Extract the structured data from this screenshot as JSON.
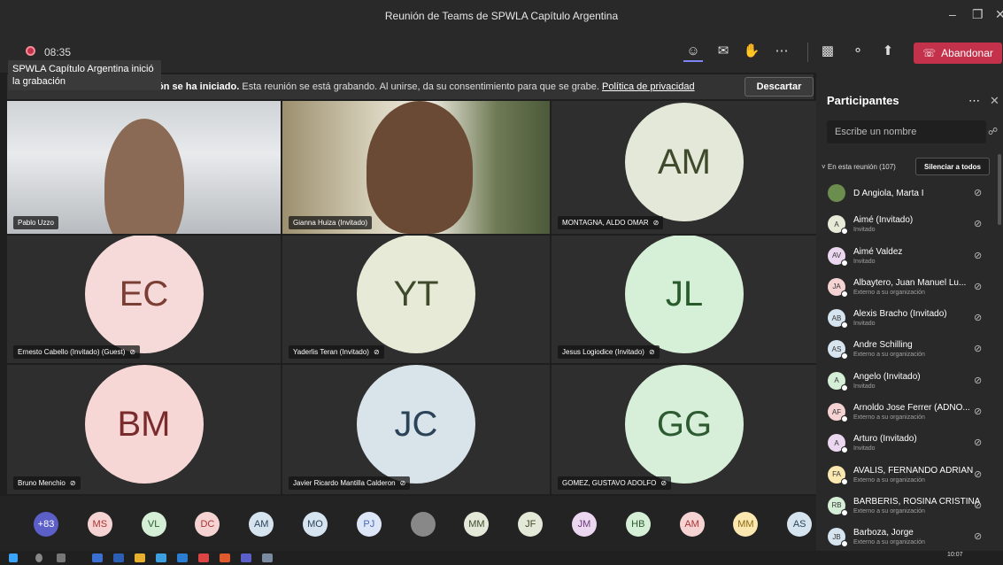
{
  "window": {
    "title": "Reunión de Teams de SPWLA Capítulo Argentina"
  },
  "toolbar": {
    "timer": "08:35",
    "leave_label": "Abandonar"
  },
  "tooltip": {
    "text": "SPWLA Capítulo Argentina inició la grabación"
  },
  "banner": {
    "bold": "ón se ha iniciado.",
    "text": " Esta reunión se está grabando. Al unirse, da su consentimiento para que se grabe. ",
    "link": "Política de privacidad",
    "dismiss_label": "Descartar"
  },
  "tiles": [
    {
      "name": "Pablo Uzzo",
      "initials": "",
      "muted": false,
      "video": "video1",
      "bg": "#2e2e2e",
      "fg": "#fff"
    },
    {
      "name": "Gianna Huiza (Invitado)",
      "initials": "",
      "muted": false,
      "video": "video2",
      "bg": "#2e2e2e",
      "fg": "#fff"
    },
    {
      "name": "MONTAGNA, ALDO OMAR",
      "initials": "AM",
      "muted": true,
      "video": "",
      "bg": "#e3e8d8",
      "fg": "#3e4a2b"
    },
    {
      "name": "Ernesto Cabello (Invitado) (Guest)",
      "initials": "EC",
      "muted": true,
      "video": "",
      "bg": "#f6dada",
      "fg": "#7a3e34"
    },
    {
      "name": "Yaderlis Teran (Invitado)",
      "initials": "YT",
      "muted": true,
      "video": "",
      "bg": "#e6ead6",
      "fg": "#3e4a2b"
    },
    {
      "name": "Jesus Logiodice (Invitado)",
      "initials": "JL",
      "muted": true,
      "video": "",
      "bg": "#d6efd7",
      "fg": "#285a2c"
    },
    {
      "name": "Bruno Menchio",
      "initials": "BM",
      "muted": true,
      "video": "",
      "bg": "#f6d7d6",
      "fg": "#7a2b2b"
    },
    {
      "name": "Javier Ricardo Mantilla Calderon",
      "initials": "JC",
      "muted": true,
      "video": "",
      "bg": "#d9e3ea",
      "fg": "#2b4358"
    },
    {
      "name": "GOMEZ, GUSTAVO ADOLFO",
      "initials": "GG",
      "muted": true,
      "video": "",
      "bg": "#d7efd9",
      "fg": "#2d5a30"
    }
  ],
  "strip": [
    {
      "label": "+83",
      "bg": "#5b5fc7",
      "fg": "#fff"
    },
    {
      "label": "MS",
      "bg": "#f6d3d3",
      "fg": "#a33"
    },
    {
      "label": "VL",
      "bg": "#d5efd6",
      "fg": "#2d5a30"
    },
    {
      "label": "DC",
      "bg": "#f6d3d3",
      "fg": "#a33"
    },
    {
      "label": "AM",
      "bg": "#d6e4f0",
      "fg": "#2b4358"
    },
    {
      "label": "MO",
      "bg": "#d6e4f0",
      "fg": "#2b4358"
    },
    {
      "label": "PJ",
      "bg": "#dce6f7",
      "fg": "#4b6bb8"
    },
    {
      "label": "",
      "bg": "#888",
      "fg": "#fff"
    },
    {
      "label": "MM",
      "bg": "#e3e8d8",
      "fg": "#3e4a2b"
    },
    {
      "label": "JF",
      "bg": "#e3e8d8",
      "fg": "#3e4a2b"
    },
    {
      "label": "JM",
      "bg": "#ebd8f0",
      "fg": "#6a3a7a"
    },
    {
      "label": "HB",
      "bg": "#d5efd6",
      "fg": "#2d5a30"
    },
    {
      "label": "AM",
      "bg": "#f6d3d3",
      "fg": "#a33"
    },
    {
      "label": "MM",
      "bg": "#fbe7b0",
      "fg": "#8a6a12"
    },
    {
      "label": "AS",
      "bg": "#d6e4f0",
      "fg": "#2b4358"
    }
  ],
  "panel": {
    "title": "Participantes",
    "search_placeholder": "Escribe un nombre",
    "section": "En esta reunión (107)",
    "mute_all": "Silenciar a todos",
    "people": [
      {
        "name": "D Angiola, Marta I",
        "sub": "",
        "initials": "",
        "bg": "#6b8e4e",
        "photo": true
      },
      {
        "name": "Aimé (Invitado)",
        "sub": "Invitado",
        "initials": "A",
        "bg": "#e6ead6",
        "photo": false
      },
      {
        "name": "Aimé Valdez",
        "sub": "Invitado",
        "initials": "AV",
        "bg": "#ebd8f0",
        "photo": false
      },
      {
        "name": "Albaytero, Juan Manuel Lu...",
        "sub": "Externo a su organización",
        "initials": "JA",
        "bg": "#f6d3d3",
        "photo": false
      },
      {
        "name": "Alexis Bracho (Invitado)",
        "sub": "Invitado",
        "initials": "AB",
        "bg": "#d6e4f0",
        "photo": false
      },
      {
        "name": "Andre Schilling",
        "sub": "Externo a su organización",
        "initials": "AS",
        "bg": "#d6e4f0",
        "photo": false
      },
      {
        "name": "Angelo (Invitado)",
        "sub": "Invitado",
        "initials": "A",
        "bg": "#d5efd6",
        "photo": false
      },
      {
        "name": "Arnoldo Jose Ferrer (ADNO...",
        "sub": "Externo a su organización",
        "initials": "AF",
        "bg": "#f6d3d3",
        "photo": false
      },
      {
        "name": "Arturo (Invitado)",
        "sub": "Invitado",
        "initials": "A",
        "bg": "#ebd8f0",
        "photo": false
      },
      {
        "name": "AVALIS, FERNANDO ADRIAN",
        "sub": "Externo a su organización",
        "initials": "FA",
        "bg": "#fbe7b0",
        "photo": false
      },
      {
        "name": "BARBERIS, ROSINA CRISTINA",
        "sub": "Externo a su organización",
        "initials": "RB",
        "bg": "#d5efd6",
        "photo": false
      },
      {
        "name": "Barboza, Jorge",
        "sub": "Externo a su organización",
        "initials": "JB",
        "bg": "#d6e4f0",
        "photo": false
      }
    ]
  },
  "taskbar": {
    "clock": "10:07"
  }
}
